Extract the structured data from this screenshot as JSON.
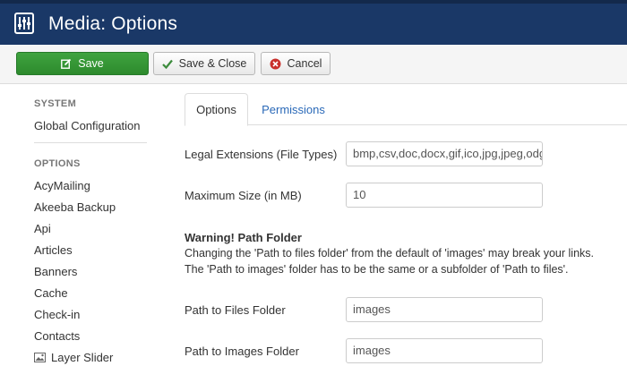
{
  "header": {
    "title": "Media: Options",
    "logo_icon": "joomla-options-icon"
  },
  "toolbar": {
    "save_label": "Save",
    "save_close_label": "Save & Close",
    "cancel_label": "Cancel"
  },
  "sidebar": {
    "system_heading": "SYSTEM",
    "global_config": "Global Configuration",
    "options_heading": "OPTIONS",
    "items": [
      "AcyMailing",
      "Akeeba Backup",
      "Api",
      "Articles",
      "Banners",
      "Cache",
      "Check-in",
      "Contacts",
      "Layer Slider"
    ]
  },
  "tabs": {
    "options": "Options",
    "permissions": "Permissions"
  },
  "form": {
    "legal_ext_label": "Legal Extensions (File Types)",
    "legal_ext_value": "bmp,csv,doc,docx,gif,ico,jpg,jpeg,odg,odp,ods,odt,pdf,png,ppt,swf,txt,xcf,xls,BMP,CSV,DOC",
    "max_size_label": "Maximum Size (in MB)",
    "max_size_value": "10",
    "warning_title": "Warning! Path Folder",
    "warning_line1": "Changing the 'Path to files folder' from the default of 'images' may break your links.",
    "warning_line2": "The 'Path to images' folder has to be the same or a subfolder of 'Path to files'.",
    "files_folder_label": "Path to Files Folder",
    "files_folder_value": "images",
    "images_folder_label": "Path to Images Folder",
    "images_folder_value": "images"
  },
  "colors": {
    "header_bg": "#1a3867",
    "save_green": "#2d8a2d",
    "link_blue": "#2a69b8",
    "cancel_red": "#c9302c"
  }
}
